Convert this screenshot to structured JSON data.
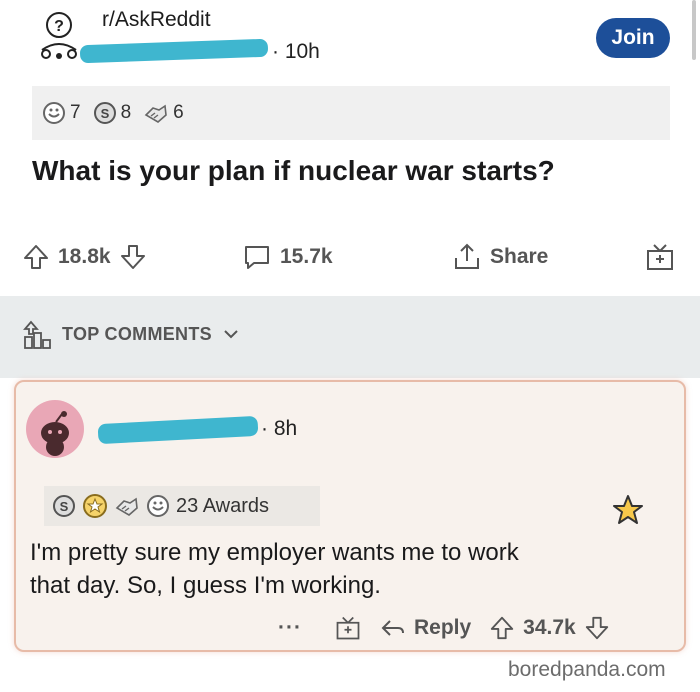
{
  "post": {
    "subreddit": "r/AskReddit",
    "meta": "· 10h",
    "join_label": "Join",
    "awards": [
      {
        "icon": "wholesome-award-icon",
        "count": "7"
      },
      {
        "icon": "silver-award-icon",
        "count": "8"
      },
      {
        "icon": "helpful-award-icon",
        "count": "6"
      }
    ],
    "title": "What is your plan if nuclear war starts?",
    "upvotes": "18.8k",
    "comments": "15.7k",
    "share_label": "Share"
  },
  "top_comments_label": "TOP COMMENTS",
  "comment": {
    "meta": "· 8h",
    "awards_label": "23 Awards",
    "text_line1": "I'm pretty sure my employer wants me to work",
    "text_line2": "that day. So, I guess I'm working.",
    "more_label": "···",
    "reply_label": "Reply",
    "score": "34.7k"
  },
  "watermark": "boredpanda.com",
  "colors": {
    "join_bg": "#1d4f99",
    "redaction": "#3fb6cf",
    "comment_bg": "#f8f2ed",
    "comment_border": "#e7bba8",
    "section_bg": "#e9eced"
  }
}
